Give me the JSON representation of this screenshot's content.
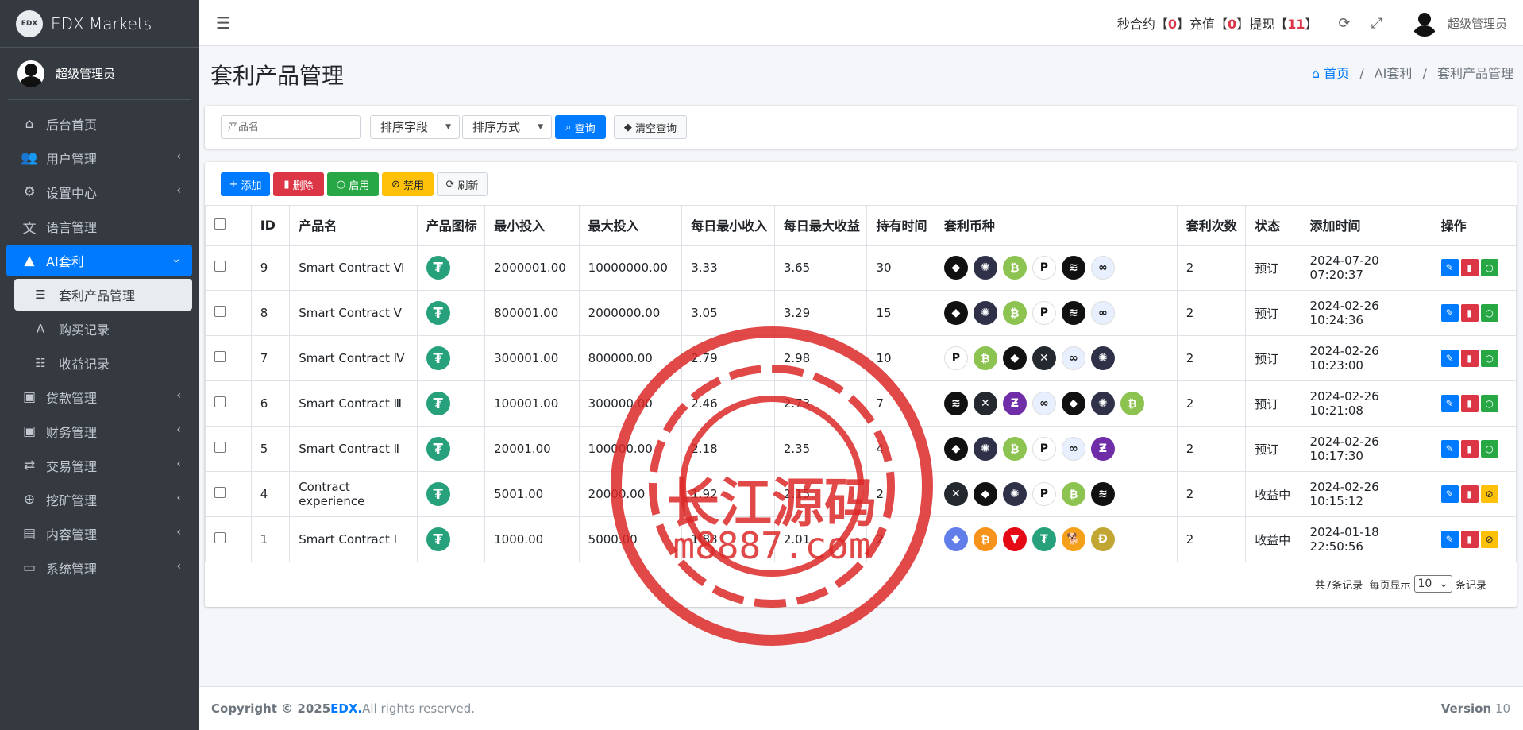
{
  "brand": {
    "logo": "EDX",
    "name": "EDX-Markets"
  },
  "user": {
    "name": "超级管理员"
  },
  "sidebar": {
    "items": [
      {
        "label": "后台首页",
        "icon": "home-icon",
        "glyph": "⌂"
      },
      {
        "label": "用户管理",
        "icon": "users-icon",
        "glyph": "👥"
      },
      {
        "label": "设置中心",
        "icon": "cogs-icon",
        "glyph": "⚙"
      },
      {
        "label": "语言管理",
        "icon": "language-icon",
        "glyph": "文"
      },
      {
        "label": "AI套利",
        "icon": "android-icon",
        "glyph": "▲"
      }
    ],
    "subitems": [
      {
        "label": "套利产品管理",
        "icon": "list-icon",
        "glyph": "☰"
      },
      {
        "label": "购买记录",
        "icon": "record-icon",
        "glyph": "A"
      },
      {
        "label": "收益记录",
        "icon": "tasks-icon",
        "glyph": "☷"
      }
    ],
    "items2": [
      {
        "label": "贷款管理",
        "icon": "money-icon",
        "glyph": "▣"
      },
      {
        "label": "财务管理",
        "icon": "money-bill-icon",
        "glyph": "▣"
      },
      {
        "label": "交易管理",
        "icon": "exchange-icon",
        "glyph": "⇄"
      },
      {
        "label": "挖矿管理",
        "icon": "search-plus-icon",
        "glyph": "⊕"
      },
      {
        "label": "内容管理",
        "icon": "newspaper-icon",
        "glyph": "▤"
      },
      {
        "label": "系统管理",
        "icon": "desktop-icon",
        "glyph": "▭"
      }
    ]
  },
  "topbar": {
    "s1": "秒合约【",
    "v1": "0",
    "s2": "】充值【",
    "v2": "0",
    "s3": "】提现【",
    "v3": "11",
    "s4": "】"
  },
  "page": {
    "title": "套利产品管理"
  },
  "breadcrumb": {
    "home": "首页",
    "mid": "AI套利",
    "current": "套利产品管理"
  },
  "search": {
    "placeholder": "产品名",
    "sort_field": "排序字段",
    "sort_order": "排序方式",
    "query": "查询",
    "clear": "清空查询"
  },
  "toolbar": {
    "add": "添加",
    "delete": "删除",
    "enable": "启用",
    "disable": "禁用",
    "refresh": "刷新"
  },
  "table": {
    "headers": [
      "ID",
      "产品名",
      "产品图标",
      "最小投入",
      "最大投入",
      "每日最小收入",
      "每日最大收益",
      "持有时间",
      "套利币种",
      "套利次数",
      "状态",
      "添加时间",
      "操作"
    ],
    "rows": [
      {
        "id": "9",
        "name": "Smart Contract Ⅵ",
        "min": "2000001.00",
        "max": "10000000.00",
        "dmin": "3.33",
        "dmax": "3.65",
        "hold": "30",
        "times": "2",
        "status": "预订",
        "time": "2024-07-20 07:20:37",
        "coins": [
          "eos",
          "atom",
          "btc",
          "dot",
          "xlm",
          "link"
        ],
        "last": "green"
      },
      {
        "id": "8",
        "name": "Smart Contract Ⅴ",
        "min": "800001.00",
        "max": "2000000.00",
        "dmin": "3.05",
        "dmax": "3.29",
        "hold": "15",
        "times": "2",
        "status": "预订",
        "time": "2024-02-26 10:24:36",
        "coins": [
          "eos",
          "atom",
          "btc",
          "dot",
          "xlm",
          "link"
        ],
        "last": "green"
      },
      {
        "id": "7",
        "name": "Smart Contract Ⅳ",
        "min": "300001.00",
        "max": "800000.00",
        "dmin": "2.79",
        "dmax": "2.98",
        "hold": "10",
        "times": "2",
        "status": "预订",
        "time": "2024-02-26 10:23:00",
        "coins": [
          "dot",
          "btc",
          "eos",
          "xrp",
          "link",
          "atom"
        ],
        "last": "green"
      },
      {
        "id": "6",
        "name": "Smart Contract Ⅲ",
        "min": "100001.00",
        "max": "300000.00",
        "dmin": "2.46",
        "dmax": "2.73",
        "hold": "7",
        "times": "2",
        "status": "预订",
        "time": "2024-02-26 10:21:08",
        "coins": [
          "xlm",
          "xrp",
          "zec",
          "link",
          "eos",
          "atom",
          "btc"
        ],
        "last": "green"
      },
      {
        "id": "5",
        "name": "Smart Contract Ⅱ",
        "min": "20001.00",
        "max": "100000.00",
        "dmin": "2.18",
        "dmax": "2.35",
        "hold": "4",
        "times": "2",
        "status": "预订",
        "time": "2024-02-26 10:17:30",
        "coins": [
          "eos",
          "atom",
          "btc",
          "dot",
          "link",
          "zec"
        ],
        "last": "green"
      },
      {
        "id": "4",
        "name": "Contract experience",
        "min": "5001.00",
        "max": "20000.00",
        "dmin": "1.92",
        "dmax": "2.15",
        "hold": "2",
        "times": "2",
        "status": "收益中",
        "time": "2024-02-26 10:15:12",
        "coins": [
          "xrp",
          "eos",
          "atom",
          "dot",
          "btc",
          "xlm"
        ],
        "last": "yellow"
      },
      {
        "id": "1",
        "name": "Smart Contract Ⅰ",
        "min": "1000.00",
        "max": "5000.00",
        "dmin": "1.83",
        "dmax": "2.01",
        "hold": "2",
        "times": "2",
        "status": "收益中",
        "time": "2024-01-18 22:50:56",
        "coins": [
          "eth",
          "btcorange",
          "trx",
          "usdt",
          "shib",
          "doge"
        ],
        "last": "yellow"
      }
    ]
  },
  "pager": {
    "total": "共7条记录",
    "per": "每页显示",
    "size": "10",
    "suffix": "条记录"
  },
  "footer": {
    "copy": "Copyright © 2025 ",
    "brand": "EDX.",
    "rights": " All rights reserved.",
    "ver_label": "Version",
    "ver": "10"
  },
  "watermark": {
    "line1": "长江源码",
    "line2": "m8887.com"
  },
  "colors": {
    "primary": "#007bff",
    "danger": "#dc3545",
    "success": "#28a745",
    "warning": "#ffc107",
    "sidebar": "#343a40"
  }
}
